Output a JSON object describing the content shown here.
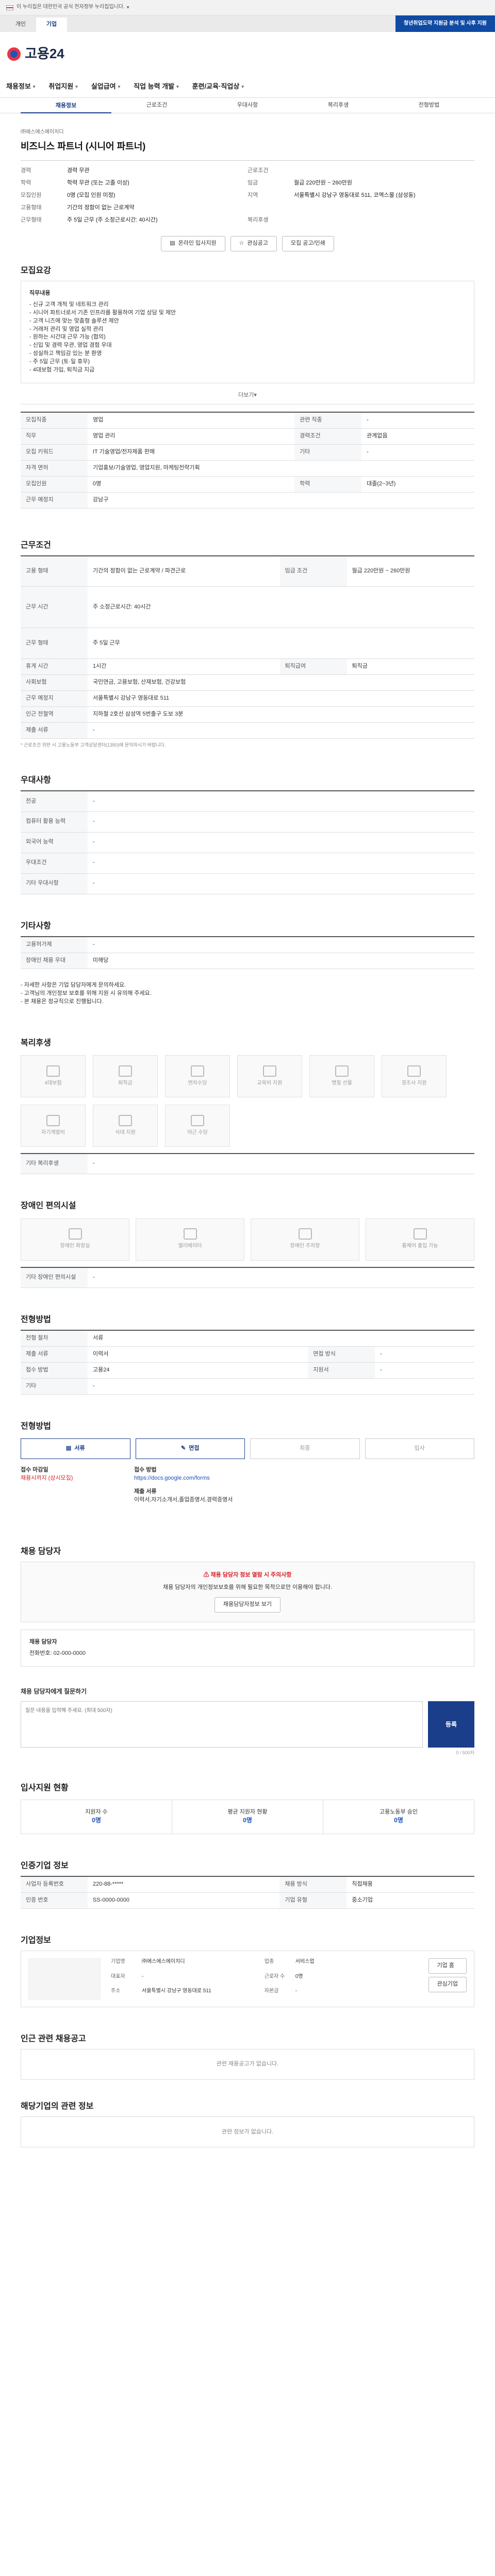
{
  "gov_banner": {
    "text": "이 누리집은 대한민국 공식 전자정부 누리집입니다."
  },
  "top_tabs": [
    "개인",
    "기업"
  ],
  "top_button": "청년취업도약 지원금 분석 및 사후 지원",
  "brand": "고용24",
  "gnb": [
    "채용정보",
    "취업지원",
    "실업급여",
    "직업 능력 개발",
    "훈련/교육·직업상"
  ],
  "sub_menu": [
    "채용정보",
    "근로조건",
    "우대사항",
    "복리후생",
    "전형방법"
  ],
  "summary": {
    "company": "㈜에스에스에이치디",
    "title": "비즈니스 파트너 (시니어 파트너)",
    "left": [
      {
        "k": "경력",
        "v": "경력 무관"
      },
      {
        "k": "학력",
        "v": "학력 무관 (또는 고졸 이상)"
      },
      {
        "k": "모집인원",
        "v": "0명 (모집 인원 미정)"
      },
      {
        "k": "고용형태",
        "v": "기간의 정함이 없는 근로계약"
      },
      {
        "k": "근무형태",
        "v": "주 5일 근무 (주 소정근로시간: 40시간)"
      }
    ],
    "right": [
      {
        "k": "근로조건",
        "v": ""
      },
      {
        "k": "임금",
        "v": "월급 220만원 ~ 260만원"
      },
      {
        "k": "지역",
        "v": "서울특별시 강남구 영동대로 511, 코엑스몰 (삼성동)"
      },
      {
        "k": "",
        "v": ""
      },
      {
        "k": "복리후생",
        "v": ""
      }
    ]
  },
  "actions": {
    "apply": "온라인 입사지원",
    "scrap": "관심공고",
    "share": "모집 공고/인쇄"
  },
  "recruit": {
    "section": "모집요강",
    "duty_title": "직무내용",
    "duty_lines": [
      "- 신규 고객 개척 및 네트워크 관리",
      "- 시니어 파트너로서 기존 인프라를 활용하여 기업 상담 및 제안",
      "- 고객 니즈에 맞는 맞춤형 솔루션 제안",
      "- 거래처 관리 및 영업 실적 관리",
      "- 원하는 시간대 근무 가능 (협의)",
      "- 신입 및 경력 무관, 영업 경험 우대",
      "- 성실하고 책임감 있는 분 환영",
      "- 주 5일 근무 (토·일 휴무)",
      "- 4대보험 가입, 퇴직금 지급"
    ],
    "more": "더보기",
    "rows": [
      {
        "k1": "모집직종",
        "v1": "영업",
        "k2": "관련 직종",
        "v2": "-"
      },
      {
        "k1": "직무",
        "v1": "영업 관리",
        "k2": "경력조건",
        "v2": "관계없음"
      },
      {
        "k1": "모집 키워드",
        "v1": "IT 기술영업/전자제품 판매",
        "k2": "기타",
        "v2": "-"
      },
      {
        "k1": "자격 면허",
        "v1": "기업홍보/기술영업, 영업지원, 마케팅전략기획",
        "k2": "",
        "v2": ""
      },
      {
        "k1": "모집인원",
        "v1": "0명",
        "k2": "학력",
        "v2": "대졸(2~3년)"
      },
      {
        "k1": "근무 예정지",
        "v1": "강남구",
        "k2": "",
        "v2": ""
      }
    ]
  },
  "conditions": {
    "section": "근무조건",
    "rows": [
      {
        "k1": "고용 형태",
        "v1": "기간의 정함이 없는 근로계약 / 파견근로",
        "k2": "임금 조건",
        "v2": "월급 220만원 ~ 260만원"
      },
      {
        "k1": "근무 시간",
        "v1": "주 소정근로시간: 40시간",
        "k2": "",
        "v2": ""
      },
      {
        "k1": "근무 형태",
        "v1": "주 5일 근무",
        "k2": "",
        "v2": ""
      },
      {
        "k1": "휴게 시간",
        "v1": "1시간",
        "k2": "퇴직급여",
        "v2": "퇴직금"
      },
      {
        "k1": "사회보험",
        "v1": "국민연금, 고용보험, 산재보험, 건강보험",
        "k2": "",
        "v2": ""
      },
      {
        "k1": "근무 예정지",
        "v1": "서울특별시 강남구 영동대로 511",
        "k2": "",
        "v2": ""
      },
      {
        "k1": "인근 전철역",
        "v1": "지하철 2호선 삼성역 5번출구 도보 3분",
        "k2": "",
        "v2": ""
      },
      {
        "k1": "제출 서류",
        "v1": "-",
        "k2": "",
        "v2": ""
      }
    ],
    "note": "* 근로조건 위반 시 고용노동부 고객상담센터(1350)에 문의하시기 바랍니다."
  },
  "preference": {
    "section": "우대사항",
    "rows": [
      {
        "k": "전공",
        "v": "-"
      },
      {
        "k": "컴퓨터 활용 능력",
        "v": "-"
      },
      {
        "k": "외국어 능력",
        "v": "-"
      },
      {
        "k": "우대조건",
        "v": "-"
      },
      {
        "k": "기타 우대사항",
        "v": "-"
      }
    ]
  },
  "other": {
    "section": "기타사항",
    "rows": [
      {
        "k": "고용허가제",
        "v": "-"
      },
      {
        "k": "장애인 채용 우대",
        "v": "미해당"
      }
    ],
    "lines": [
      "- 자세한 사항은 기업 담당자에게 문의하세요.",
      "- 고객님의 개인정보 보호를 위해 지원 시 유의해 주세요.",
      "- 본 채용은 정규직으로 진행됩니다."
    ]
  },
  "welfare": {
    "section": "복리후생",
    "items": [
      "4대보험",
      "퇴직금",
      "연차수당",
      "교육비 지원",
      "명절 선물",
      "경조사 지원",
      "자기계발비",
      "식대 지원",
      "야근 수당"
    ],
    "extra_label": "기타 복리후생",
    "extra_value": "-"
  },
  "disabled": {
    "section": "장애인 편의시설",
    "items": [
      "장애인 화장실",
      "엘리베이터",
      "장애인 주차장",
      "휠체어 출입 가능"
    ],
    "extra_label": "기타 장애인 편의시설",
    "extra_value": "-"
  },
  "screening": {
    "section": "전형방법",
    "rows": [
      {
        "k1": "전형 절차",
        "v1": "서류",
        "k2": "",
        "v2": ""
      },
      {
        "k1": "제출 서류",
        "v1": "이력서",
        "k2": "면접 방식",
        "v2": "-"
      },
      {
        "k1": "접수 방법",
        "v1": "고용24",
        "k2": "지원서",
        "v2": "-"
      },
      {
        "k1": "기타",
        "v1": "-",
        "k2": "",
        "v2": ""
      }
    ]
  },
  "process": {
    "section": "전형방법",
    "steps": [
      "서류",
      "면접",
      "최종",
      "입사"
    ],
    "deadline_label": "접수 마감일",
    "deadline": "채용시까지 (상시모집)",
    "method_label": "접수 방법",
    "method": "https://docs.google.com/forms",
    "doc_label": "제출 서류",
    "doc": "이력서,자기소개서,졸업증명서,경력증명서"
  },
  "manager": {
    "section": "채용 담당자",
    "warn1": "채용 담당자 정보 열람 시 주의사항",
    "warn2": "채용 담당자의 개인정보보호를 위해 필요한 목적으로만 이용해야 합니다.",
    "btn": "채용담당자정보 보기",
    "name_label": "채용 담당자",
    "phone": "전화번호: 02-000-0000"
  },
  "inquiry": {
    "section": "채용 담당자에게 질문하기",
    "placeholder": "질문 내용을 입력해 주세요. (최대 500자)",
    "send": "등록",
    "count": "0 / 500자"
  },
  "apply_status": {
    "section": "입사지원 현황",
    "items": [
      {
        "k": "지원자 수",
        "v": "0명"
      },
      {
        "k": "평균 지원자 현황",
        "v": "0명"
      },
      {
        "k": "고용노동부 승인",
        "v": "0명"
      }
    ]
  },
  "info": {
    "section": "인증기업 정보",
    "rows": [
      {
        "k1": "사업자 등록번호",
        "v1": "220-88-*****",
        "k2": "채용 방식",
        "v2": "직접채용"
      },
      {
        "k1": "인증 번호",
        "v1": "SS-0000-0000",
        "k2": "기업 유형",
        "v2": "중소기업"
      }
    ]
  },
  "company_info": {
    "section": "기업정보",
    "rows": [
      [
        "기업명",
        "㈜에스에스에이치디",
        "업종",
        "서비스업"
      ],
      [
        "대표자",
        "-",
        "근로자 수",
        "0명"
      ],
      [
        "주소",
        "서울특별시 강남구 영동대로 511",
        "자본금",
        "-"
      ]
    ],
    "buttons": [
      "기업 홈",
      "관심기업"
    ]
  },
  "other_jobs": {
    "section": "인근 관련 채용공고",
    "empty": "관련 채용공고가 없습니다."
  },
  "similar_jobs": {
    "section": "해당기업의 관련 정보",
    "empty": "관련 정보가 없습니다."
  }
}
